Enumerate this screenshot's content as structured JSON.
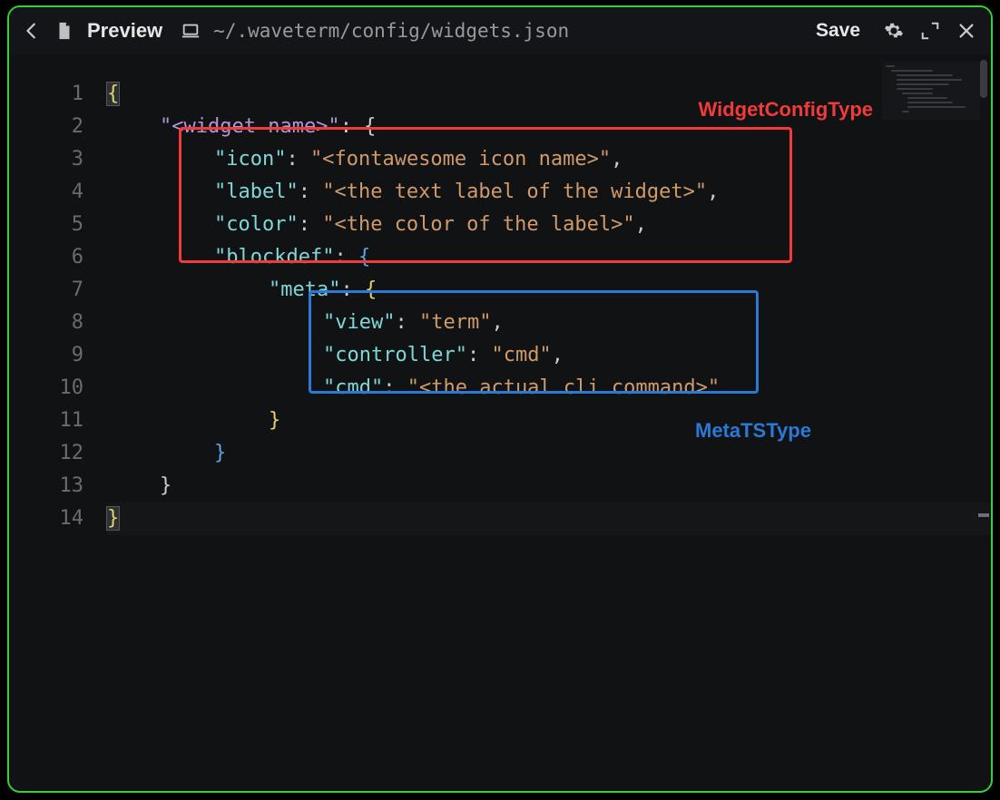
{
  "header": {
    "title": "Preview",
    "path": "~/.waveterm/config/widgets.json",
    "save_label": "Save"
  },
  "annotations": {
    "red_label": "WidgetConfigType",
    "blue_label": "MetaTSType"
  },
  "code": {
    "line_count": 14,
    "lines": {
      "l1": {
        "brace": "{"
      },
      "l2": {
        "key": "\"<widget name>\"",
        "after": ": {"
      },
      "l3": {
        "key": "\"icon\"",
        "colon": ": ",
        "val": "\"<fontawesome icon name>\"",
        "trail": ","
      },
      "l4": {
        "key": "\"label\"",
        "colon": ": ",
        "val": "\"<the text label of the widget>\"",
        "trail": ","
      },
      "l5": {
        "key": "\"color\"",
        "colon": ": ",
        "val": "\"<the color of the label>\"",
        "trail": ","
      },
      "l6": {
        "key": "\"blockdef\"",
        "colon": ": ",
        "brace": "{"
      },
      "l7": {
        "key": "\"meta\"",
        "colon": ": ",
        "brace": "{"
      },
      "l8": {
        "key": "\"view\"",
        "colon": ": ",
        "val": "\"term\"",
        "trail": ","
      },
      "l9": {
        "key": "\"controller\"",
        "colon": ": ",
        "val": "\"cmd\"",
        "trail": ","
      },
      "l10": {
        "key": "\"cmd\"",
        "colon": ": ",
        "val": "\"<the actual cli command>\""
      },
      "l11": {
        "brace": "}"
      },
      "l12": {
        "brace": "}"
      },
      "l13": {
        "brace": "}"
      },
      "l14": {
        "brace": "}"
      }
    }
  }
}
